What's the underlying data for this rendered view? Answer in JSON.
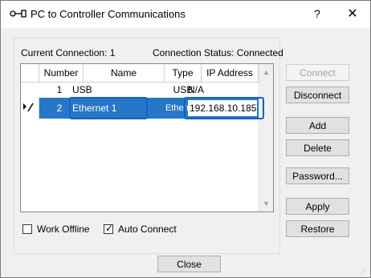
{
  "window": {
    "title": "PC to Controller Communications",
    "help": "?",
    "close": "✕"
  },
  "status": {
    "current_connection": "Current Connection: 1",
    "connection_status": "Connection Status: Connected"
  },
  "table": {
    "headers": [
      "Number",
      "Name",
      "Type",
      "IP Address"
    ],
    "rows": [
      {
        "number": "1",
        "name": "USB",
        "type": "USB",
        "ip": "N/A"
      },
      {
        "number": "2",
        "name": "Ethernet 1",
        "type": "Ethernet",
        "ip": "192.168.10.185"
      }
    ],
    "selected_row": 1
  },
  "buttons": {
    "connect": "Connect",
    "disconnect": "Disconnect",
    "add": "Add",
    "delete": "Delete",
    "password": "Password...",
    "apply": "Apply",
    "restore": "Restore",
    "close": "Close"
  },
  "options": {
    "work_offline": {
      "label": "Work Offline",
      "checked": false
    },
    "auto_connect": {
      "label": "Auto Connect",
      "checked": true
    }
  },
  "colors": {
    "selection": "#2677c8",
    "highlight_box": "#1560c6"
  },
  "icons": {
    "title": "connection-plug-icon",
    "row_indicator": "current-row-edit-icon"
  }
}
